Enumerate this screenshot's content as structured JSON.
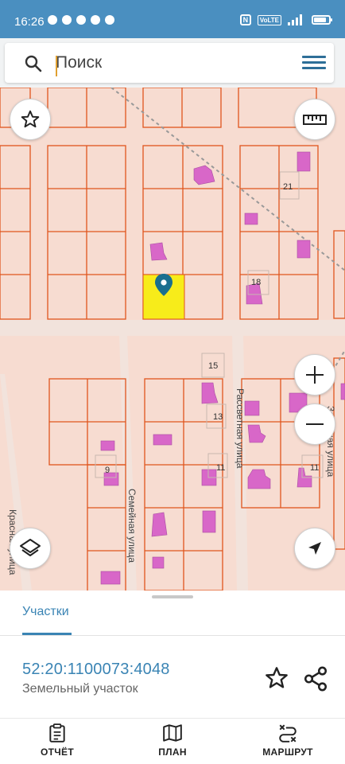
{
  "status_bar": {
    "time": "16:26",
    "network": "4G",
    "volte": "VoLTE"
  },
  "search": {
    "placeholder": "Поиск"
  },
  "map": {
    "street_labels": {
      "rassvetnaya": "Рассветная улица",
      "semeynaya": "Семейная улица",
      "krasnaya": "Красная улица",
      "zarechnaya": "Заречная улица"
    },
    "house_numbers": {
      "n21": "21",
      "n18": "18",
      "n15": "15",
      "n13": "13",
      "n11a": "11",
      "n11b": "11",
      "n9": "9"
    },
    "colors": {
      "background": "#f7dcd1",
      "parcel_border": "#e0551d",
      "building": "#d867c8",
      "selected_parcel": "#f7ec1a",
      "marker": "#1a6f8f"
    }
  },
  "sheet": {
    "tab_label": "Участки",
    "parcel_id": "52:20:1100073:4048",
    "parcel_type": "Земельный участок"
  },
  "bottom_nav": {
    "report": "ОТЧЁТ",
    "plan": "ПЛАН",
    "route": "МАРШРУТ"
  },
  "accent_color": "#3a84b4"
}
